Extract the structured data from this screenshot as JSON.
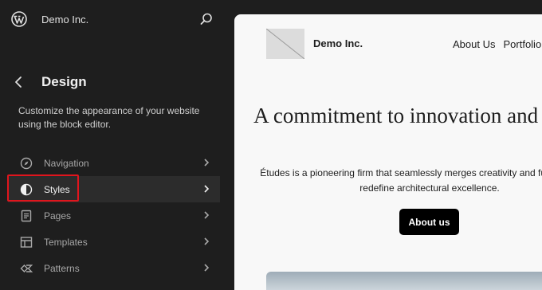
{
  "header": {
    "site_name": "Demo Inc.",
    "logo_icon": "wordpress-logo-icon",
    "search_icon": "search-icon"
  },
  "design": {
    "title": "Design",
    "description": "Customize the appearance of your website using the block editor."
  },
  "nav": {
    "items": [
      {
        "label": "Navigation",
        "icon": "compass-icon",
        "active": false
      },
      {
        "label": "Styles",
        "icon": "half-circle-icon",
        "active": true
      },
      {
        "label": "Pages",
        "icon": "page-icon",
        "active": false
      },
      {
        "label": "Templates",
        "icon": "layout-icon",
        "active": false
      },
      {
        "label": "Patterns",
        "icon": "diamond-icon",
        "active": false
      }
    ]
  },
  "preview": {
    "site_title": "Demo Inc.",
    "nav_links": [
      "About Us",
      "Portfolio"
    ],
    "hero_title": "A commitment to innovation and sustainability",
    "hero_text": "Études is a pioneering firm that seamlessly merges creativity and functionality to redefine architectural excellence.",
    "button_label": "About us"
  },
  "colors": {
    "sidebar_bg": "#1e1e1e",
    "active_item_bg": "#2c2c2c",
    "highlight_border": "#e0151d",
    "preview_bg": "#f8f8f8",
    "button_bg": "#000000"
  }
}
